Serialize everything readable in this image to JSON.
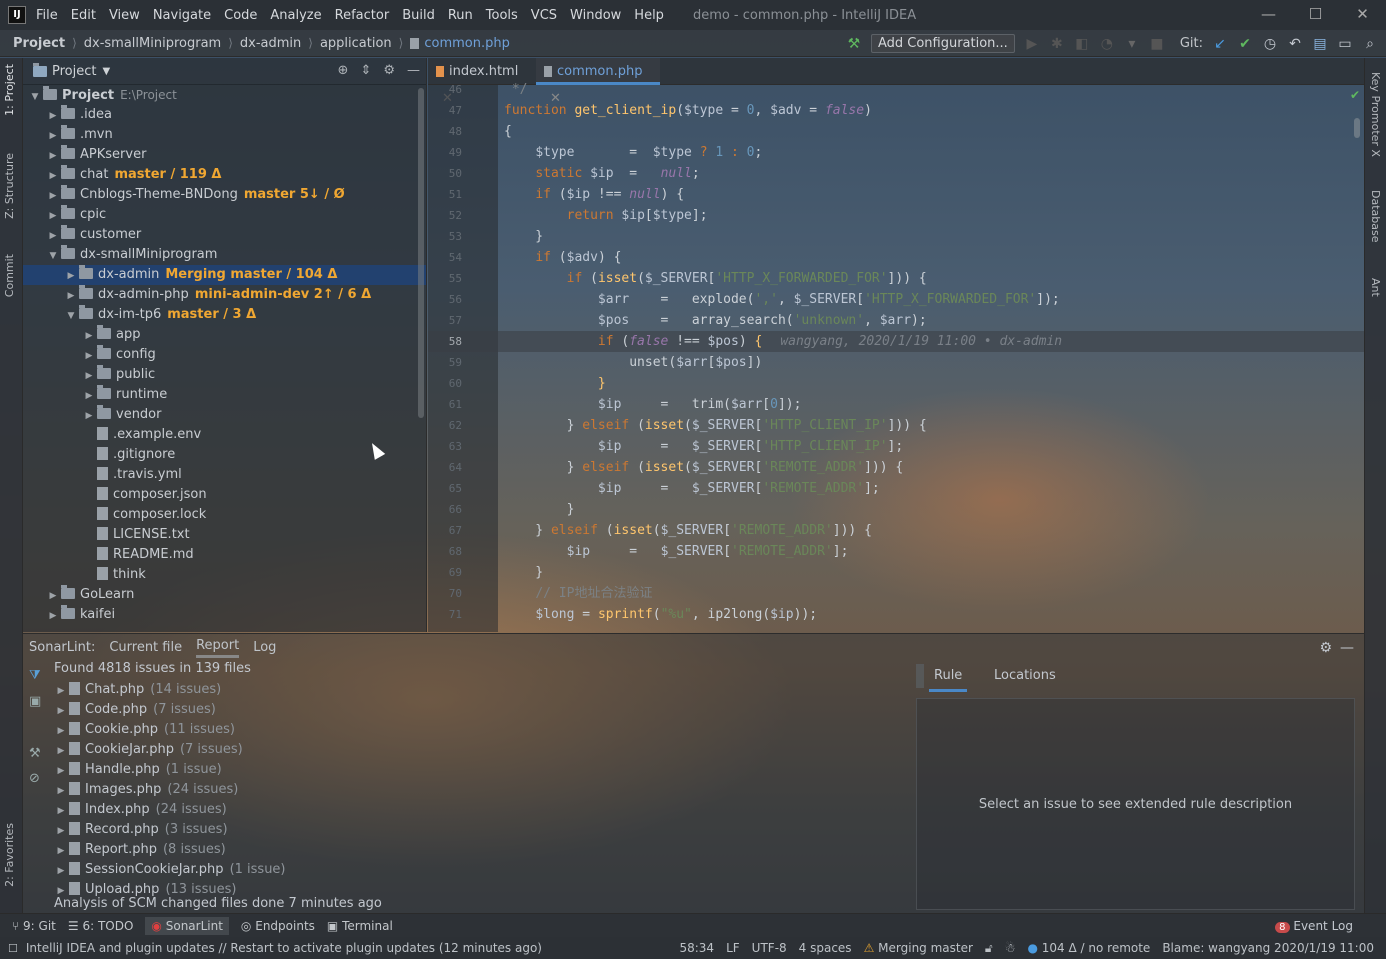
{
  "titlebar": {
    "menus": [
      "File",
      "Edit",
      "View",
      "Navigate",
      "Code",
      "Analyze",
      "Refactor",
      "Build",
      "Run",
      "Tools",
      "VCS",
      "Window",
      "Help"
    ],
    "title": "demo - common.php - IntelliJ IDEA",
    "min": "—",
    "max": "☐",
    "close": "✕"
  },
  "navbar": {
    "crumbs": [
      "Project",
      "dx-smallMiniprogram",
      "dx-admin",
      "application",
      "common.php"
    ],
    "add_config": "Add Configuration...",
    "git_label": "Git:"
  },
  "left_tabs": [
    "1: Project",
    "Z: Structure",
    "Commit",
    "2: Favorites"
  ],
  "right_tabs": [
    "Key Promoter X",
    "Database",
    "Ant"
  ],
  "project": {
    "header": "Project",
    "tree": [
      {
        "label": "Project",
        "extra": "E:\\Project",
        "indent": 0,
        "type": "folder",
        "arrow": "▼"
      },
      {
        "label": ".idea",
        "indent": 1,
        "type": "folder",
        "arrow": "▶"
      },
      {
        "label": ".mvn",
        "indent": 1,
        "type": "folder",
        "arrow": "▶"
      },
      {
        "label": "APKserver",
        "indent": 1,
        "type": "folder",
        "arrow": "▶"
      },
      {
        "label": "chat",
        "git": "master / 119 Δ",
        "indent": 1,
        "type": "folder",
        "arrow": "▶"
      },
      {
        "label": "Cnblogs-Theme-BNDong",
        "git": "master 5↓ / Ø",
        "indent": 1,
        "type": "folder",
        "arrow": "▶"
      },
      {
        "label": "cpic",
        "indent": 1,
        "type": "folder",
        "arrow": "▶"
      },
      {
        "label": "customer",
        "indent": 1,
        "type": "folder",
        "arrow": "▶"
      },
      {
        "label": "dx-smallMiniprogram",
        "indent": 1,
        "type": "folder",
        "arrow": "▼"
      },
      {
        "label": "dx-admin",
        "git": "Merging master / 104 Δ",
        "indent": 2,
        "type": "folder",
        "arrow": "▶",
        "selected": true
      },
      {
        "label": "dx-admin-php",
        "git": "mini-admin-dev 2↑ / 6 Δ",
        "indent": 2,
        "type": "folder",
        "arrow": "▶"
      },
      {
        "label": "dx-im-tp6",
        "git": "master / 3 Δ",
        "indent": 2,
        "type": "folder",
        "arrow": "▼"
      },
      {
        "label": "app",
        "indent": 3,
        "type": "folder",
        "arrow": "▶"
      },
      {
        "label": "config",
        "indent": 3,
        "type": "folder",
        "arrow": "▶"
      },
      {
        "label": "public",
        "indent": 3,
        "type": "folder",
        "arrow": "▶"
      },
      {
        "label": "runtime",
        "indent": 3,
        "type": "folder",
        "arrow": "▶"
      },
      {
        "label": "vendor",
        "indent": 3,
        "type": "folder",
        "arrow": "▶"
      },
      {
        "label": ".example.env",
        "indent": 3,
        "type": "file",
        "arrow": ""
      },
      {
        "label": ".gitignore",
        "indent": 3,
        "type": "file",
        "arrow": ""
      },
      {
        "label": ".travis.yml",
        "indent": 3,
        "type": "file",
        "arrow": ""
      },
      {
        "label": "composer.json",
        "indent": 3,
        "type": "file",
        "arrow": ""
      },
      {
        "label": "composer.lock",
        "indent": 3,
        "type": "file",
        "arrow": ""
      },
      {
        "label": "LICENSE.txt",
        "indent": 3,
        "type": "file",
        "arrow": ""
      },
      {
        "label": "README.md",
        "indent": 3,
        "type": "file",
        "arrow": ""
      },
      {
        "label": "think",
        "indent": 3,
        "type": "file",
        "arrow": ""
      },
      {
        "label": "GoLearn",
        "indent": 1,
        "type": "folder",
        "arrow": "▶"
      },
      {
        "label": "kaifei",
        "indent": 1,
        "type": "folder",
        "arrow": "▶"
      }
    ]
  },
  "editor": {
    "tabs": [
      "index.html",
      "common.php"
    ],
    "lines": [
      {
        "n": "46",
        "html": "<span class='cmt'> */</span>"
      },
      {
        "n": "47",
        "html": "<span class='kw'>function</span> <span class='fn'>get_client_ip</span>(<span class='var'>$type</span> = <span class='num'>0</span>, <span class='var'>$adv</span> = <span class='ital'>false</span>)"
      },
      {
        "n": "48",
        "html": "{"
      },
      {
        "n": "49",
        "html": "    <span class='var'>$type</span>       =  <span class='var'>$type</span> <span class='kw'>?</span> <span class='num'>1</span> <span class='kw'>:</span> <span class='num'>0</span>;"
      },
      {
        "n": "50",
        "html": "    <span class='kw'>static</span> <span class='var'>$ip</span>  =   <span class='ital'>null</span>;"
      },
      {
        "n": "51",
        "html": "    <span class='kw'>if</span> (<span class='var'>$ip</span> !== <span class='ital'>null</span>) {"
      },
      {
        "n": "52",
        "html": "        <span class='kw'>return</span> <span class='var'>$ip</span>[<span class='var'>$type</span>];"
      },
      {
        "n": "53",
        "html": "    }"
      },
      {
        "n": "54",
        "html": "    <span class='kw'>if</span> (<span class='var'>$adv</span>) {"
      },
      {
        "n": "55",
        "html": "        <span class='kw'>if</span> (<span class='fn'>isset</span>(<span class='var'>$_SERVER</span>[<span class='str'>'HTTP_X_FORWARDED_FOR'</span>])) {"
      },
      {
        "n": "56",
        "html": "            <span class='var'>$arr</span>    =   explode(<span class='str'>','</span>, <span class='var'>$_SERVER</span>[<span class='str'>'HTTP_X_FORWARDED_FOR'</span>]);"
      },
      {
        "n": "57",
        "html": "            <span class='var'>$pos</span>    =   array_search(<span class='str'>'unknown'</span>, <span class='var'>$arr</span>);"
      },
      {
        "n": "58",
        "html": "            <span class='kw'>if</span> (<span class='ital'>false</span> !== <span class='var'>$pos</span>) <span class='fn'>{</span><span class='blame'>wangyang, 2020/1/19 11:00 • dx-admin</span>",
        "cur": true
      },
      {
        "n": "59",
        "html": "                unset(<span class='var'>$arr</span>[<span class='var'>$pos</span>])"
      },
      {
        "n": "60",
        "html": "            <span class='fn'>}</span>"
      },
      {
        "n": "61",
        "html": "            <span class='var'>$ip</span>     =   trim(<span class='var'>$arr</span>[<span class='num'>0</span>]);"
      },
      {
        "n": "62",
        "html": "        } <span class='kw'>elseif</span> (<span class='fn'>isset</span>(<span class='var'>$_SERVER</span>[<span class='str'>'HTTP_CLIENT_IP'</span>])) {"
      },
      {
        "n": "63",
        "html": "            <span class='var'>$ip</span>     =   <span class='var'>$_SERVER</span>[<span class='str'>'HTTP_CLIENT_IP'</span>];"
      },
      {
        "n": "64",
        "html": "        } <span class='kw'>elseif</span> (<span class='fn'>isset</span>(<span class='var'>$_SERVER</span>[<span class='str'>'REMOTE_ADDR'</span>])) {"
      },
      {
        "n": "65",
        "html": "            <span class='var'>$ip</span>     =   <span class='var'>$_SERVER</span>[<span class='str'>'REMOTE_ADDR'</span>];"
      },
      {
        "n": "66",
        "html": "        }"
      },
      {
        "n": "67",
        "html": "    } <span class='kw'>elseif</span> (<span class='fn'>isset</span>(<span class='var'>$_SERVER</span>[<span class='str'>'REMOTE_ADDR'</span>])) {"
      },
      {
        "n": "68",
        "html": "        <span class='var'>$ip</span>     =   <span class='var'>$_SERVER</span>[<span class='str'>'REMOTE_ADDR'</span>];"
      },
      {
        "n": "69",
        "html": "    }"
      },
      {
        "n": "70",
        "html": "    <span class='cmt'>// IP地址合法验证</span>"
      },
      {
        "n": "71",
        "html": "    <span class='var'>$long</span> = <span class='fn'>sprintf</span>(<span class='str'>\"%u\"</span>, ip2long(<span class='var'>$ip</span>));"
      }
    ]
  },
  "sonar": {
    "label": "SonarLint:",
    "tabs": [
      "Current file",
      "Report",
      "Log"
    ],
    "found": "Found 4818 issues in 139 files",
    "issues": [
      {
        "file": "Chat.php",
        "count": "(14 issues)"
      },
      {
        "file": "Code.php",
        "count": "(7 issues)"
      },
      {
        "file": "Cookie.php",
        "count": "(11 issues)"
      },
      {
        "file": "CookieJar.php",
        "count": "(7 issues)"
      },
      {
        "file": "Handle.php",
        "count": "(1 issue)"
      },
      {
        "file": "Images.php",
        "count": "(24 issues)"
      },
      {
        "file": "Index.php",
        "count": "(24 issues)"
      },
      {
        "file": "Record.php",
        "count": "(3 issues)"
      },
      {
        "file": "Report.php",
        "count": "(8 issues)"
      },
      {
        "file": "SessionCookieJar.php",
        "count": "(1 issue)"
      },
      {
        "file": "Upload.php",
        "count": "(13 issues)"
      }
    ],
    "analysis": "Analysis of SCM changed files done 7 minutes ago",
    "rule_tabs": [
      "Rule",
      "Locations"
    ],
    "rule_placeholder": "Select an issue to see extended rule description"
  },
  "toolwindows": [
    "9: Git",
    "6: TODO",
    "SonarLint",
    "Endpoints",
    "Terminal"
  ],
  "event_log": {
    "count": "8",
    "label": "Event Log"
  },
  "status": {
    "message": "IntelliJ IDEA and plugin updates // Restart to activate plugin updates (12 minutes ago)",
    "pos": "58:34",
    "le": "LF",
    "enc": "UTF-8",
    "indent": "4 spaces",
    "branch": "Merging master",
    "vcs": "104 Δ / no remote",
    "blame": "Blame: wangyang 2020/1/19 11:00"
  }
}
